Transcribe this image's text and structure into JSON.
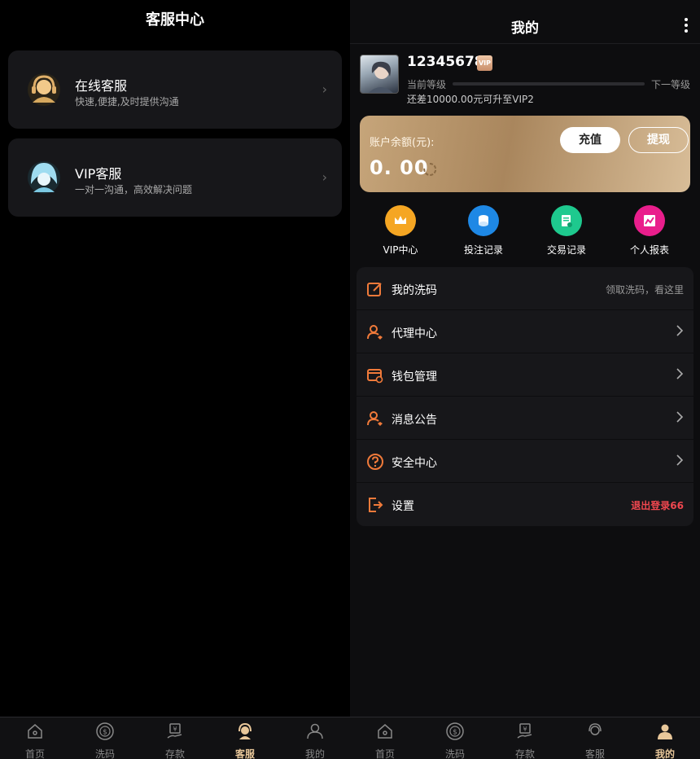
{
  "left": {
    "title": "客服中心",
    "cards": [
      {
        "title": "在线客服",
        "subtitle": "快速,便捷,及时提供沟通"
      },
      {
        "title": "VIP客服",
        "subtitle": "一对一沟通，高效解决问题"
      }
    ],
    "tabs": [
      {
        "label": "首页",
        "icon": "home-icon",
        "active": false
      },
      {
        "label": "洗码",
        "icon": "dollar-circle-icon",
        "active": false
      },
      {
        "label": "存款",
        "icon": "deposit-icon",
        "active": false
      },
      {
        "label": "客服",
        "icon": "headset-icon",
        "active": true
      },
      {
        "label": "我的",
        "icon": "user-icon",
        "active": false
      }
    ]
  },
  "right": {
    "title": "我的",
    "user": {
      "name": "12345678",
      "vip_badge": "VIP",
      "level_current_label": "当前等级",
      "level_next_label": "下一等级",
      "level_progress": 0,
      "upgrade_hint": "还差10000.00元可升至VIP2"
    },
    "balance": {
      "label": "账户余额(元):",
      "amount": "0. 00",
      "charge_label": "充值",
      "withdraw_label": "提现"
    },
    "quick": [
      {
        "label": "VIP中心",
        "icon": "crown-icon",
        "color": "#f5a623"
      },
      {
        "label": "投注记录",
        "icon": "coins-icon",
        "color": "#1e88e5"
      },
      {
        "label": "交易记录",
        "icon": "document-icon",
        "color": "#1ec98e"
      },
      {
        "label": "个人报表",
        "icon": "chart-icon",
        "color": "#e91e8c"
      }
    ],
    "menu": [
      {
        "label": "我的洗码",
        "icon": "edit-icon",
        "right": "领取洗码，看这里"
      },
      {
        "label": "代理中心",
        "icon": "agent-icon",
        "right": ""
      },
      {
        "label": "钱包管理",
        "icon": "wallet-icon",
        "right": ""
      },
      {
        "label": "消息公告",
        "icon": "message-icon",
        "right": ""
      },
      {
        "label": "安全中心",
        "icon": "question-icon",
        "right": ""
      },
      {
        "label": "设置",
        "icon": "logout-icon",
        "right": "退出登录66"
      }
    ],
    "tabs": [
      {
        "label": "首页",
        "icon": "home-icon",
        "active": false
      },
      {
        "label": "洗码",
        "icon": "dollar-circle-icon",
        "active": false
      },
      {
        "label": "存款",
        "icon": "deposit-icon",
        "active": false
      },
      {
        "label": "客服",
        "icon": "headset-icon",
        "active": false
      },
      {
        "label": "我的",
        "icon": "user-icon",
        "active": true
      }
    ]
  },
  "colors": {
    "accent_gold": "#e8c79a",
    "icon_orange": "#f07a3a",
    "logout_red": "#f0474f"
  }
}
